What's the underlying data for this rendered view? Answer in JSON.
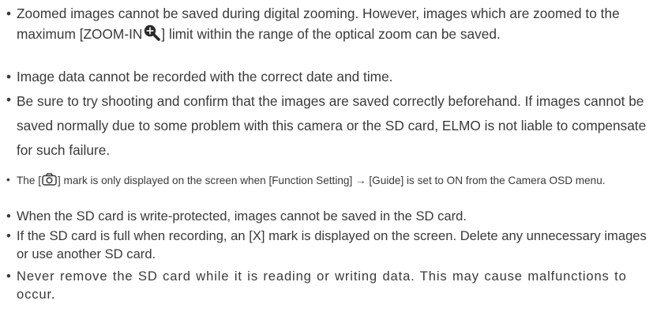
{
  "notes": [
    {
      "bullet": "•",
      "part1": "Zoomed images cannot be saved during digital zooming. However, images which are zoomed to the maximum [ZOOM-IN",
      "part2": "] limit within the range of the optical zoom can be saved.",
      "icon": "zoom-in-magnifier-icon"
    },
    {
      "bullet": "•",
      "text": "Image data cannot be recorded with the correct date and time."
    },
    {
      "bullet": "•",
      "text": "Be sure to try shooting and confirm that the images are saved correctly beforehand. If images cannot be saved normally due to some problem with this camera or the SD card, ELMO is not liable to compensate for such failure."
    },
    {
      "bullet": "•",
      "part1": "The [",
      "part2": "] mark is only displayed on the screen when [Function Setting] → [Guide] is set to ON from the Camera OSD menu.",
      "icon": "camera-icon"
    },
    {
      "bullet": "•",
      "text": "When the SD card is write-protected, images cannot be saved in the SD card."
    },
    {
      "bullet": "•",
      "text": "If the SD card is full when recording, an [X] mark is displayed on the screen. Delete any unnecessary images or use another SD card."
    },
    {
      "bullet": "•",
      "text": "Never remove the SD card while it is reading or writing data. This may cause malfunctions to occur."
    }
  ]
}
